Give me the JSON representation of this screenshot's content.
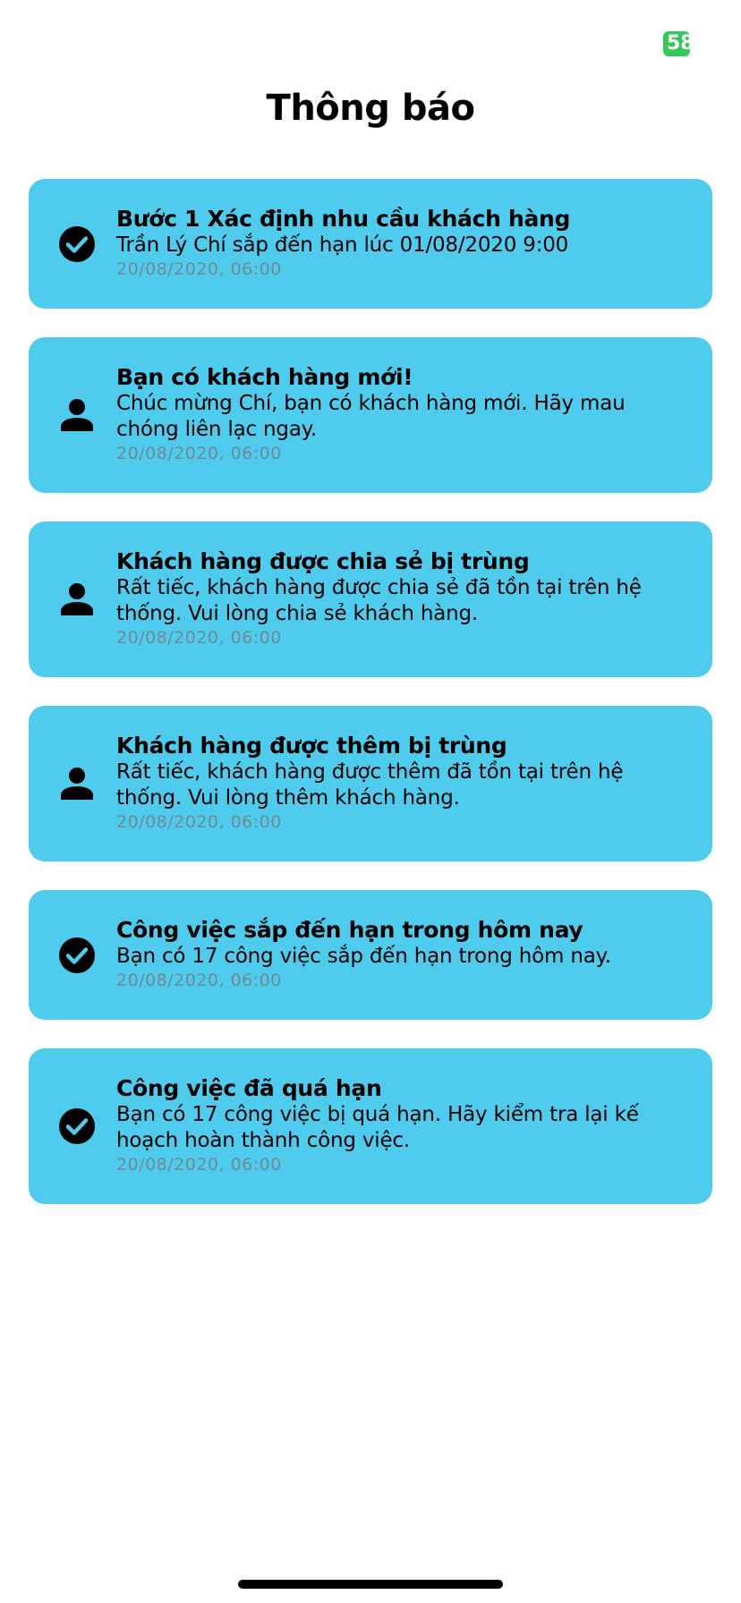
{
  "status_bar": {
    "battery_level": "58"
  },
  "header": {
    "title": "Thông báo"
  },
  "colors": {
    "card_background": "#4fcbee",
    "battery": "#34c759",
    "time_text": "#6f8b94"
  },
  "notifications": [
    {
      "icon": "check-circle-icon",
      "title": "Bước 1 Xác định nhu cầu khách hàng",
      "message": "Trần Lý Chí sắp đến hạn lúc 01/08/2020 9:00",
      "time": "20/08/2020, 06:00"
    },
    {
      "icon": "person-icon",
      "title": "Bạn có khách hàng mới!",
      "message": "Chúc mừng Chí, bạn có khách hàng mới. Hãy mau chóng liên lạc ngay.",
      "time": "20/08/2020, 06:00"
    },
    {
      "icon": "person-icon",
      "title": "Khách hàng được chia sẻ bị trùng",
      "message": "Rất tiếc, khách hàng được chia sẻ đã tồn tại trên hệ thống. Vui lòng chia sẻ khách hàng.",
      "time": "20/08/2020, 06:00"
    },
    {
      "icon": "person-icon",
      "title": "Khách hàng được thêm bị trùng",
      "message": "Rất tiếc, khách hàng được thêm đã tồn tại trên hệ thống. Vui lòng thêm khách hàng.",
      "time": "20/08/2020, 06:00"
    },
    {
      "icon": "check-circle-icon",
      "title": "Công việc sắp đến hạn trong hôm nay",
      "message": "Bạn có 17 công việc sắp đến hạn trong hôm nay.",
      "time": "20/08/2020, 06:00"
    },
    {
      "icon": "check-circle-icon",
      "title": "Công việc đã quá hạn",
      "message": "Bạn có 17 công việc bị quá hạn. Hãy kiểm tra lại kế hoạch hoàn thành công việc.",
      "time": "20/08/2020, 06:00"
    }
  ]
}
